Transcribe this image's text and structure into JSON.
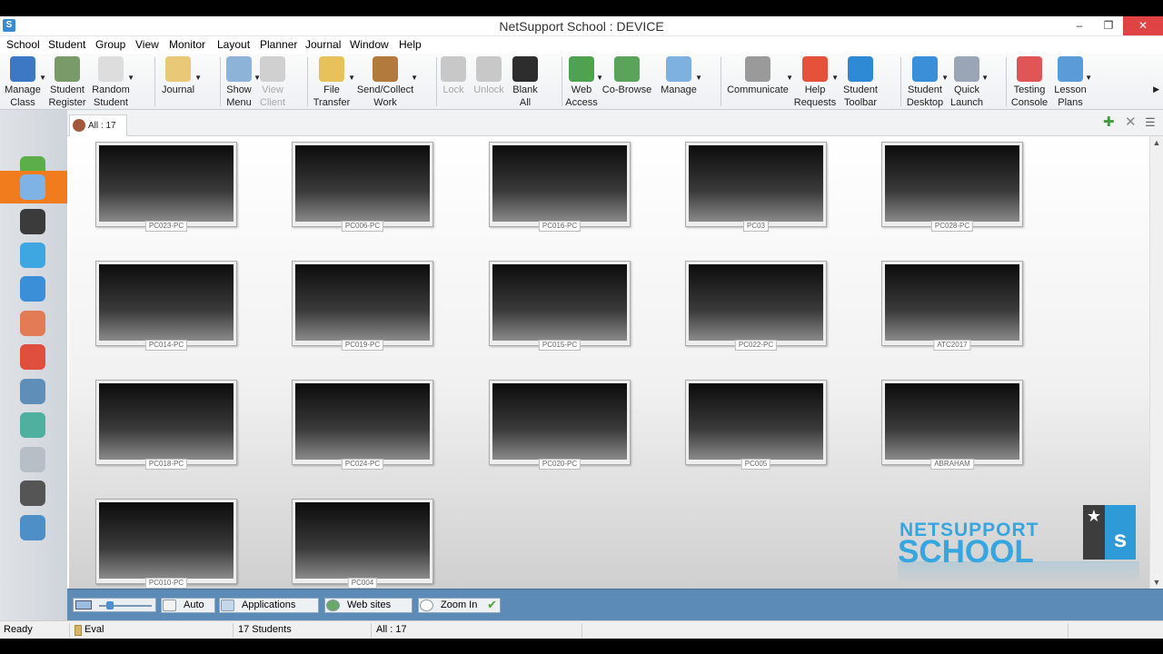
{
  "window": {
    "title": "NetSupport School : DEVICE",
    "app_icon": "S",
    "minimize_glyph": "–",
    "restore_glyph": "❐",
    "close_glyph": "✕"
  },
  "menu": [
    "School",
    "Student",
    "Group",
    "View",
    "Monitor",
    "Layout",
    "Planner",
    "Journal",
    "Window",
    "Help"
  ],
  "toolbar": [
    {
      "label": "Manage\nClass",
      "icon": "manage-class-icon",
      "color": "#3d78c4",
      "dd": true
    },
    {
      "label": "Student\nRegister",
      "icon": "student-register-icon",
      "color": "#7a9a6a",
      "dd": false
    },
    {
      "label": "Random\nStudent",
      "icon": "dice-icon",
      "color": "#dddddd",
      "dd": true
    },
    {
      "label": "Journal",
      "icon": "journal-icon",
      "color": "#e8c978",
      "dd": true
    },
    {
      "label": "Show\nMenu",
      "icon": "show-menu-icon",
      "color": "#8db3d9",
      "dd": true
    },
    {
      "label": "View\nClient",
      "icon": "view-client-icon",
      "color": "#d0d0d0",
      "dd": false,
      "disabled": true
    },
    {
      "label": "File\nTransfer",
      "icon": "file-transfer-icon",
      "color": "#e7c25a",
      "dd": true
    },
    {
      "label": "Send/Collect\nWork",
      "icon": "send-collect-icon",
      "color": "#b27a3d",
      "dd": true
    },
    {
      "label": "Lock",
      "icon": "lock-icon",
      "color": "#c8c8c8",
      "dd": false,
      "disabled": true
    },
    {
      "label": "Unlock",
      "icon": "unlock-icon",
      "color": "#c8c8c8",
      "dd": false,
      "disabled": true
    },
    {
      "label": "Blank\nAll",
      "icon": "blank-screen-icon",
      "color": "#2d2d2d",
      "dd": false
    },
    {
      "label": "Web\nAccess",
      "icon": "globe-lock-icon",
      "color": "#4fa24f",
      "dd": true
    },
    {
      "label": "Co-Browse",
      "icon": "co-browse-icon",
      "color": "#5ba35b",
      "dd": false
    },
    {
      "label": "Manage",
      "icon": "manage-icon",
      "color": "#7eb0e0",
      "dd": true
    },
    {
      "label": "Communicate",
      "icon": "communicate-icon",
      "color": "#9a9a9a",
      "dd": true
    },
    {
      "label": "Help\nRequests",
      "icon": "lifebuoy-icon",
      "color": "#e4523a",
      "dd": true
    },
    {
      "label": "Student\nToolbar",
      "icon": "student-toolbar-icon",
      "color": "#2f8ad6",
      "dd": false
    },
    {
      "label": "Student\nDesktop",
      "icon": "student-desktop-icon",
      "color": "#3a8fd8",
      "dd": true
    },
    {
      "label": "Quick\nLaunch",
      "icon": "rocket-icon",
      "color": "#9aa6b6",
      "dd": true
    },
    {
      "label": "Testing\nConsole",
      "icon": "testing-console-icon",
      "color": "#e05555",
      "dd": false
    },
    {
      "label": "Lesson\nPlans",
      "icon": "puzzle-icon",
      "color": "#5a9bd8",
      "dd": true
    }
  ],
  "toolbar_more": "▶",
  "sidebar": [
    {
      "name": "home-icon",
      "color": "#5cae4a"
    },
    {
      "name": "thumbnails-icon",
      "color": "#7fb3e6",
      "active": true
    },
    {
      "name": "headphones-icon",
      "color": "#3b3b3b"
    },
    {
      "name": "question-icon",
      "color": "#3ea6e0"
    },
    {
      "name": "globe-icon",
      "color": "#3a8fd8"
    },
    {
      "name": "applications-icon",
      "color": "#e37b57"
    },
    {
      "name": "pie-chart-icon",
      "color": "#e04e3e"
    },
    {
      "name": "printer-icon",
      "color": "#5f8fb8"
    },
    {
      "name": "users-icon",
      "color": "#4fb0a0"
    },
    {
      "name": "cd-icon",
      "color": "#b8bec6"
    },
    {
      "name": "keyboard-icon",
      "color": "#555555"
    },
    {
      "name": "chart-icon",
      "color": "#4f8fc8"
    }
  ],
  "tab": {
    "label": "All : 17",
    "add_glyph": "✚",
    "close_glyph": "✕",
    "details_glyph": "☰"
  },
  "scroll": {
    "up": "▲",
    "down": "▼"
  },
  "students": [
    "PC023-PC",
    "PC006-PC",
    "PC016-PC",
    "PC03",
    "PC028-PC",
    "PC014-PC",
    "PC019-PC",
    "PC015-PC",
    "PC022-PC",
    "ATC2017",
    "PC018-PC",
    "PC024-PC",
    "PC020-PC",
    "PC005",
    "ABRAHAM",
    "PC010-PC",
    "PC004"
  ],
  "logo": {
    "line1": "NETSUPPORT",
    "line2": "SCHOOL",
    "mark_letter": "s",
    "mark_star": "★"
  },
  "bottombar": {
    "auto": "Auto",
    "applications": "Applications",
    "websites": "Web sites",
    "zoom_in": "Zoom In",
    "zoom_check": "✔",
    "slider_level": 0.15
  },
  "status": {
    "ready": "Ready",
    "eval": "Eval",
    "students": "17 Students",
    "all": "All : 17"
  },
  "colors": {
    "accent": "#f07c1d",
    "logo": "#35a6e0",
    "bottombar": "#5d8bb8"
  }
}
